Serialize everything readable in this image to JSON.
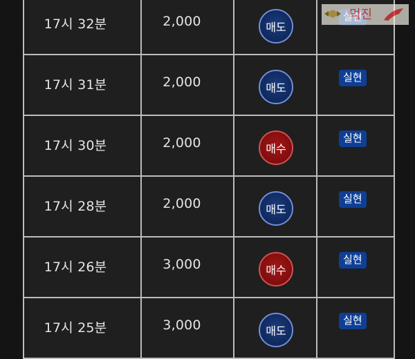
{
  "rows": [
    {
      "time": "17시 32분",
      "amount": "2,000",
      "side": "매도",
      "side_type": "sell",
      "status": "실현"
    },
    {
      "time": "17시 31분",
      "amount": "2,000",
      "side": "매도",
      "side_type": "sell",
      "status": "실현"
    },
    {
      "time": "17시 30분",
      "amount": "2,000",
      "side": "매수",
      "side_type": "buy",
      "status": "실현"
    },
    {
      "time": "17시 28분",
      "amount": "2,000",
      "side": "매도",
      "side_type": "sell",
      "status": "실현"
    },
    {
      "time": "17시 26분",
      "amount": "3,000",
      "side": "매수",
      "side_type": "buy",
      "status": "실현"
    },
    {
      "time": "17시 25분",
      "amount": "3,000",
      "side": "매도",
      "side_type": "sell",
      "status": "실현"
    }
  ],
  "watermark": {
    "text": "먹진"
  },
  "colors": {
    "sell": "#10285c",
    "buy": "#7d0d0d",
    "badge": "#0f3f95",
    "background": "#1f1f1f"
  }
}
